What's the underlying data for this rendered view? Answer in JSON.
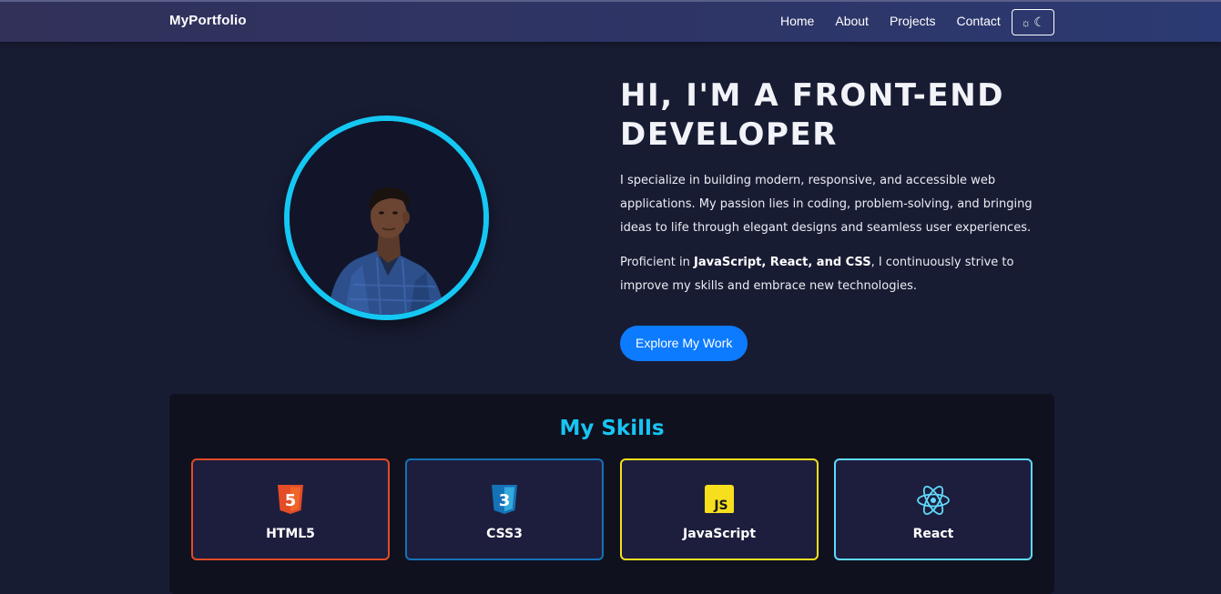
{
  "nav": {
    "brand": "MyPortfolio",
    "links": [
      "Home",
      "About",
      "Projects",
      "Contact"
    ],
    "theme_toggle": {
      "sun_icon": "☼",
      "moon_icon": "☾"
    }
  },
  "hero": {
    "title": "Hi, I'm a Front-End Developer",
    "paragraph1": "I specialize in building modern, responsive, and accessible web applications. My passion lies in coding, problem-solving, and bringing ideas to life through elegant designs and seamless user experiences.",
    "paragraph2_prefix": "Proficient in ",
    "paragraph2_bold": "JavaScript, React, and CSS",
    "paragraph2_suffix": ", I continuously strive to improve my skills and embrace new technologies.",
    "cta_label": "Explore My Work"
  },
  "skills": {
    "title": "My Skills",
    "items": [
      {
        "label": "HTML5",
        "icon": "html5-icon",
        "color": "#e34c26",
        "glyph": "5"
      },
      {
        "label": "CSS3",
        "icon": "css3-icon",
        "color": "#1572b6",
        "glyph": "3"
      },
      {
        "label": "JavaScript",
        "icon": "javascript-icon",
        "color": "#f7df1e",
        "glyph": "JS"
      },
      {
        "label": "React",
        "icon": "react-icon",
        "color": "#61dafb",
        "glyph": ""
      }
    ]
  },
  "colors": {
    "accent": "#14c8f3",
    "button": "#0d7bff",
    "background": "#181c33"
  }
}
